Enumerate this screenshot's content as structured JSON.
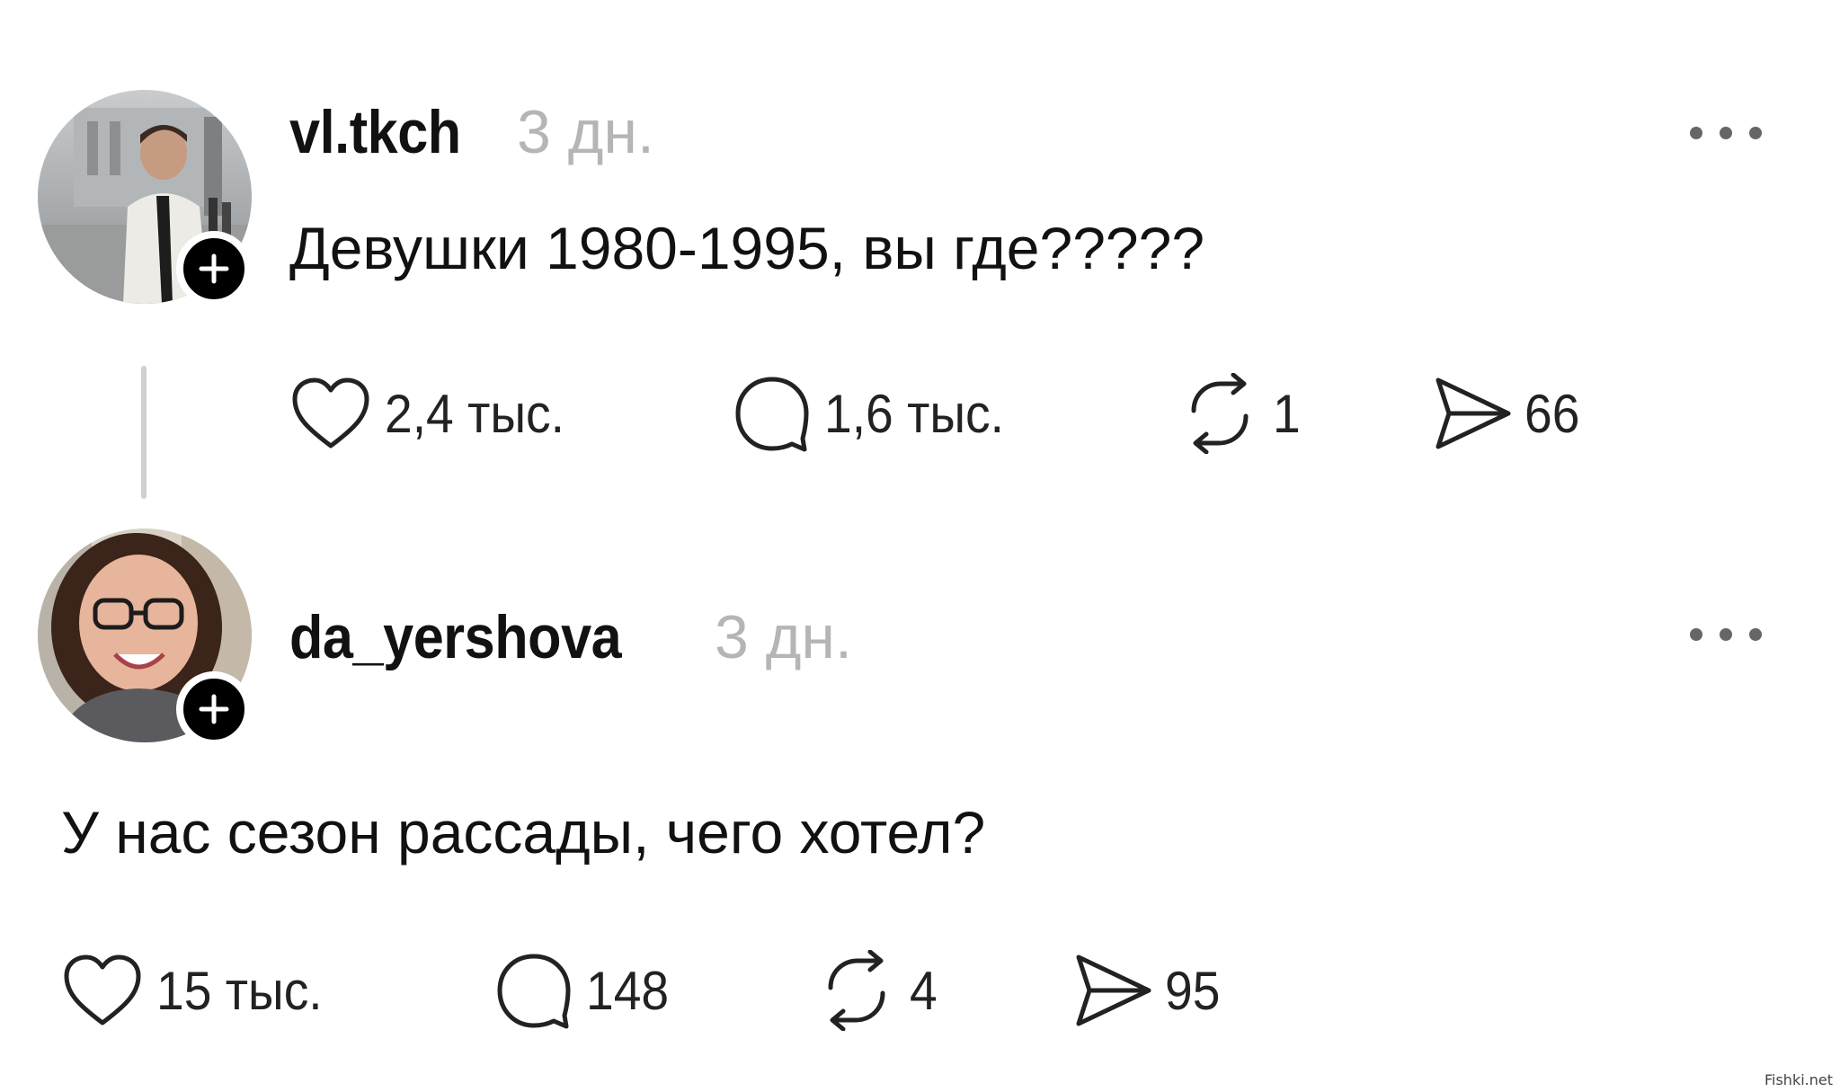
{
  "posts": [
    {
      "username": "vl.tkch",
      "timestamp": "3 дн.",
      "text": "Девушки 1980-1995, вы где?????",
      "likes": "2,4 тыс.",
      "comments": "1,6 тыс.",
      "reposts": "1",
      "shares": "66",
      "avatar_icon": "avatar-photo-man"
    },
    {
      "username": "da_yershova",
      "timestamp": "3 дн.",
      "text": "У нас сезон рассады, чего хотел?",
      "likes": "15 тыс.",
      "comments": "148",
      "reposts": "4",
      "shares": "95",
      "avatar_icon": "avatar-photo-woman"
    }
  ],
  "icons": {
    "like": "heart-icon",
    "comment": "comment-bubble-icon",
    "repost": "repost-icon",
    "share": "send-icon",
    "follow": "plus-icon",
    "more": "more-dots-icon"
  },
  "watermark": "Fishki.net"
}
